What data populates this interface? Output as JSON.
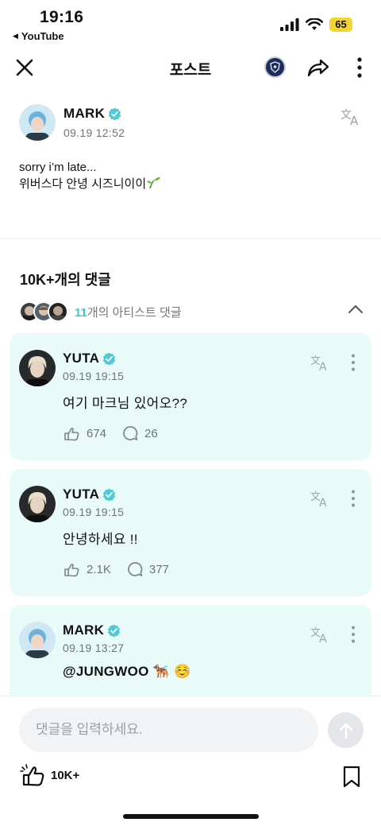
{
  "status": {
    "time": "19:16",
    "back_app": "YouTube",
    "battery": "65"
  },
  "nav": {
    "title": "포스트"
  },
  "post": {
    "author": "MARK",
    "timestamp": "09.19 12:52",
    "line1": "sorry i’m late...",
    "line2": "위버스다 안녕 시즈니이이"
  },
  "comments_section": {
    "count_label": "10K+개의 댓글",
    "artist_count": "11",
    "artist_label": "개의 아티스트 댓글"
  },
  "comments": [
    {
      "author": "YUTA",
      "timestamp": "09.19 19:15",
      "text": "여기 마크님 있어오??",
      "likes": "674",
      "replies": "26"
    },
    {
      "author": "YUTA",
      "timestamp": "09.19 19:15",
      "text": "안녕하세요 !!",
      "likes": "2.1K",
      "replies": "377"
    },
    {
      "author": "MARK",
      "timestamp": "09.19 13:27",
      "text": "@JUNGWOO 🐕‍🦺 ☺️"
    }
  ],
  "bottom": {
    "input_placeholder": "댓글을 입력하세요.",
    "likes": "10K+"
  },
  "colors": {
    "accent": "#3dc6d3",
    "card_bg": "#e9fbf8",
    "verified": "#50c9d6"
  }
}
